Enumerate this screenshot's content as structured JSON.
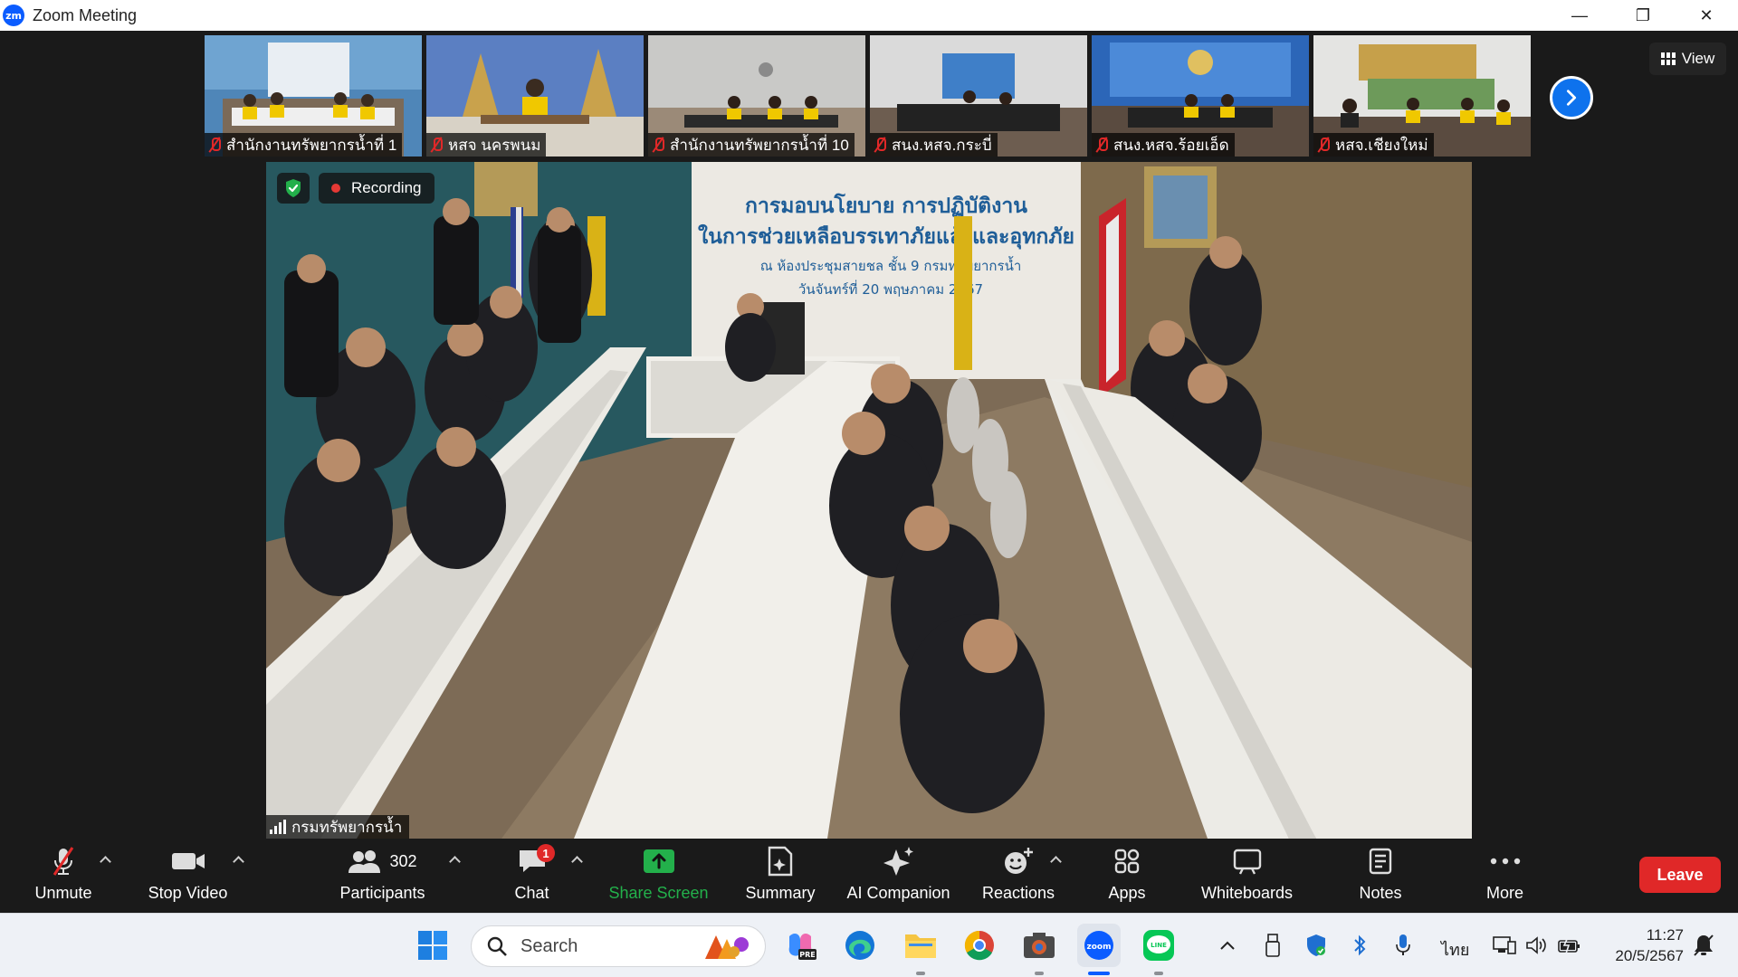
{
  "window": {
    "app_icon_text": "zm",
    "title": "Zoom Meeting",
    "minimize": "—",
    "restore": "❐",
    "close": "✕"
  },
  "gallery": {
    "tiles": [
      {
        "name": "สำนักงานทรัพยากรน้ำที่ 1"
      },
      {
        "name": "หสจ นครพนม"
      },
      {
        "name": "สำนักงานทรัพยากรน้ำที่ 10"
      },
      {
        "name": "สนง.หสจ.กระบี่"
      },
      {
        "name": "สนง.หสจ.ร้อยเอ็ด"
      },
      {
        "name": "หสจ.เชียงใหม่"
      }
    ],
    "view_label": "View"
  },
  "main_video": {
    "recording_label": "Recording",
    "speaker_name": "กรมทรัพยากรน้ำ",
    "banner": {
      "line1": "การมอบนโยบาย การปฏิบัติงาน",
      "line2": "ในการช่วยเหลือบรรเทาภัยแล้งและอุทกภัย",
      "line3": "ณ ห้องประชุมสายชล ชั้น 9 กรมทรัพยากรน้ำ",
      "line4": "วันจันทร์ที่ 20 พฤษภาคม 2567"
    }
  },
  "toolbar": {
    "unmute": "Unmute",
    "stop_video": "Stop Video",
    "participants": "Participants",
    "participants_count": "302",
    "chat": "Chat",
    "chat_badge": "1",
    "share_screen": "Share Screen",
    "summary": "Summary",
    "ai_companion": "AI Companion",
    "reactions": "Reactions",
    "apps": "Apps",
    "whiteboards": "Whiteboards",
    "notes": "Notes",
    "more": "More",
    "leave": "Leave"
  },
  "taskbar": {
    "search_placeholder": "Search",
    "zoom_app_label": "zoom",
    "copilot_label": "PRE",
    "line_app_label": "LINE",
    "language": "ไทย",
    "time": "11:27",
    "date": "20/5/2567"
  },
  "colors": {
    "zoom_blue": "#0b5cff",
    "leave_red": "#e02828",
    "share_green": "#23b04b",
    "toolbar_bg": "#1a1a1a"
  }
}
